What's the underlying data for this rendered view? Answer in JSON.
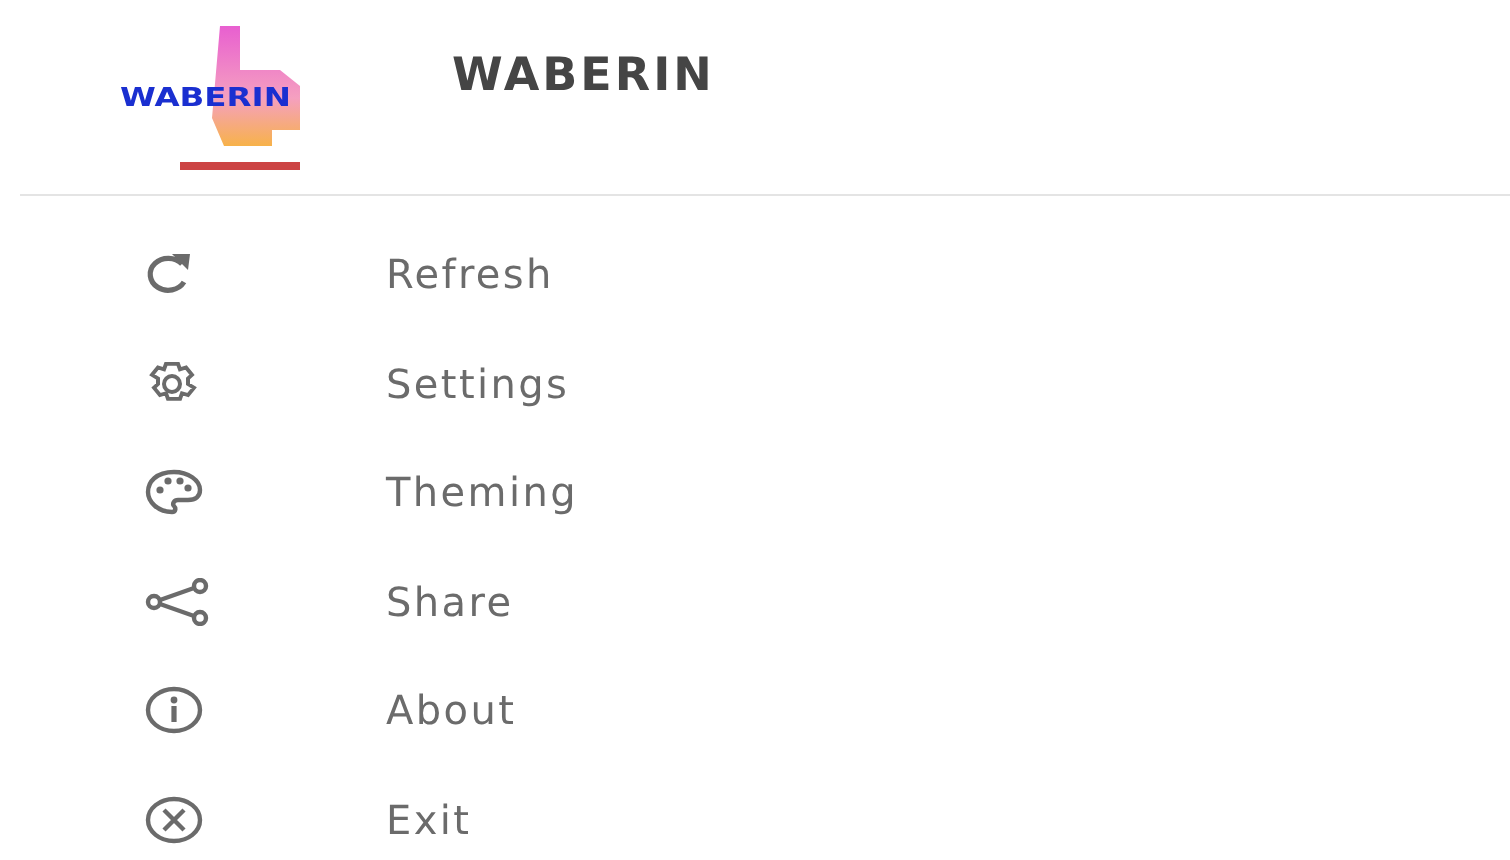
{
  "header": {
    "logo_text": "WABERIN",
    "title": "WABERIN"
  },
  "menu": [
    {
      "label": "Refresh"
    },
    {
      "label": "Settings"
    },
    {
      "label": "Theming"
    },
    {
      "label": "Share"
    },
    {
      "label": "About"
    },
    {
      "label": "Exit"
    }
  ]
}
